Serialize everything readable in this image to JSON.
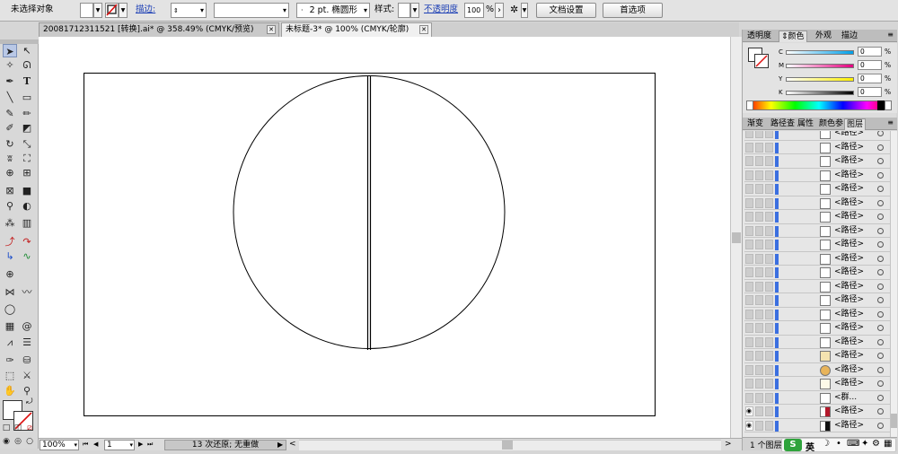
{
  "control_bar": {
    "selection_label": "未选择对象",
    "stroke_link": "描边:",
    "brush_size": "2 pt. 椭圆形",
    "style_label": "样式:",
    "opacity_link": "不透明度",
    "opacity_value": "100",
    "opacity_unit": "%",
    "doc_setup_button": "文档设置",
    "preferences_button": "首选项",
    "dropdown_arrow": "▾"
  },
  "document_tabs": [
    {
      "label": "20081712311521 [转换].ai* @ 358.49% (CMYK/预览)",
      "close": "✕"
    },
    {
      "label": "未标题-3* @ 100% (CMYK/轮廓)",
      "close": "✕"
    }
  ],
  "color_panel": {
    "tabs": [
      "透明度",
      "颜色",
      "外观",
      "描边"
    ],
    "channels": [
      {
        "key": "C",
        "value": "0",
        "unit": "%"
      },
      {
        "key": "M",
        "value": "0",
        "unit": "%"
      },
      {
        "key": "Y",
        "value": "0",
        "unit": "%"
      },
      {
        "key": "K",
        "value": "0",
        "unit": "%"
      }
    ]
  },
  "layers_panel": {
    "tabs": [
      "渐变",
      "路径查",
      "属性",
      "颜色参",
      "图层"
    ],
    "rows": [
      {
        "label": "<路径>"
      },
      {
        "label": "<路径>"
      },
      {
        "label": "<路径>"
      },
      {
        "label": "<路径>"
      },
      {
        "label": "<路径>"
      },
      {
        "label": "<路径>"
      },
      {
        "label": "<路径>"
      },
      {
        "label": "<路径>"
      },
      {
        "label": "<路径>"
      },
      {
        "label": "<路径>"
      },
      {
        "label": "<路径>"
      },
      {
        "label": "<路径>"
      },
      {
        "label": "<路径>"
      },
      {
        "label": "<路径>"
      },
      {
        "label": "<路径>"
      },
      {
        "label": "<路径>"
      },
      {
        "label": "<路径>"
      },
      {
        "label": "<路径>"
      },
      {
        "label": "<路径>"
      },
      {
        "label": "<群..."
      },
      {
        "label": "<路径>"
      },
      {
        "label": "<路径>"
      }
    ],
    "footer": "1 个图层"
  },
  "status_bar": {
    "zoom": "100%",
    "page": "1",
    "undo_text": "13 次还原; 无重做",
    "nav_first": "⏮",
    "nav_prev": "◀",
    "nav_next": "▶",
    "nav_last": "⏭",
    "play": "▶",
    "scroll_left": "<",
    "scroll_right": ">"
  },
  "ime_bar": {
    "logo": "S",
    "lang": "英",
    "icons": [
      "☽",
      "•",
      "⌨",
      "✦",
      "⚙",
      "▦"
    ]
  },
  "colors": {
    "accent_blue": "#1c3fb5",
    "layer_blue": "#3b6fe0",
    "ime_green": "#2fa33c"
  }
}
